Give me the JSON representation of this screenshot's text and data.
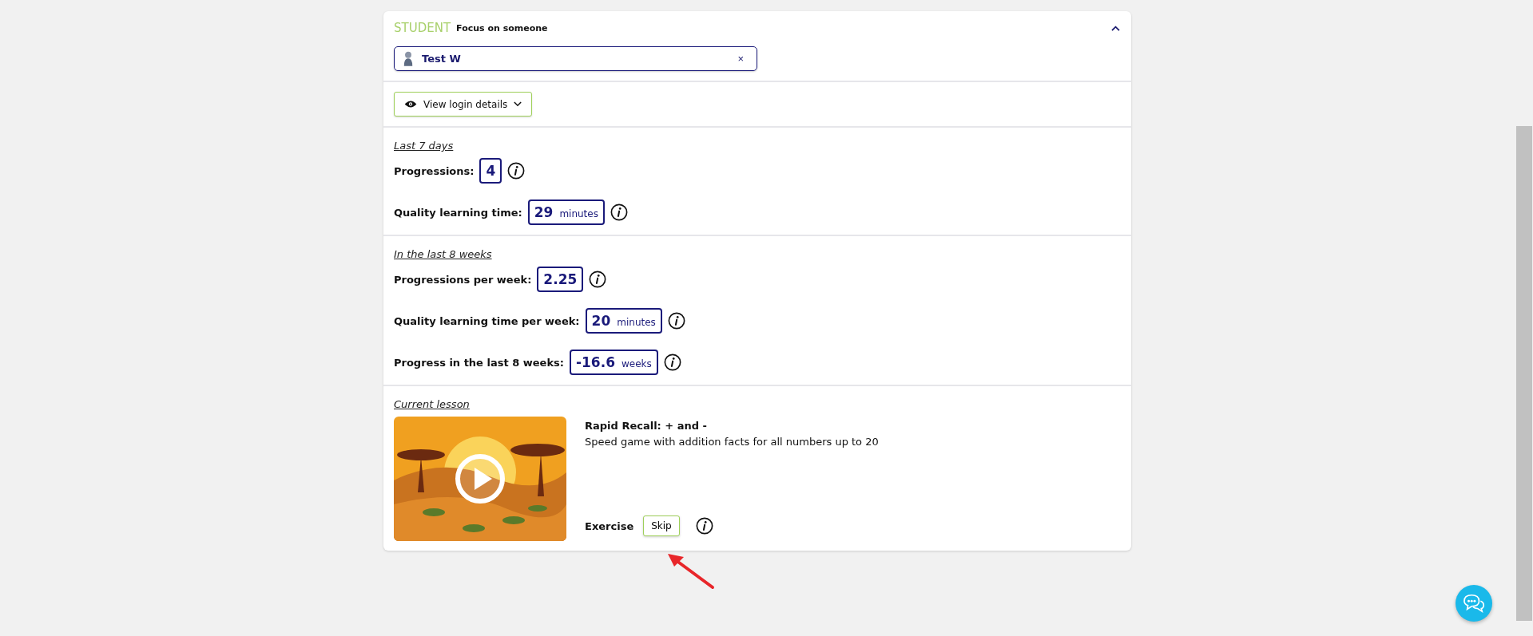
{
  "student": {
    "label": "STUDENT",
    "caption": "Focus on someone",
    "expanded": true,
    "selected_name": "Test W",
    "clear": "×"
  },
  "login_button": {
    "label": "View login details",
    "expanded": false
  },
  "sections": [
    {
      "heading": "Last 7 days",
      "stats": [
        {
          "label": "Progressions:",
          "value": "4"
        },
        {
          "label": "Quality learning time:",
          "value": "29",
          "unit": "minutes"
        }
      ]
    },
    {
      "heading": "In the last 8 weeks",
      "stats": [
        {
          "label": "Progressions per week:",
          "value": "2.25"
        },
        {
          "label": "Quality learning time per week:",
          "value": "20",
          "unit": "minutes"
        },
        {
          "label": "Progress in the last 8 weeks:",
          "value": "-16.6",
          "unit": "weeks"
        }
      ]
    }
  ],
  "lesson": {
    "heading": "Current lesson",
    "title": "Rapid Recall: + and -",
    "description": "Speed game with addition facts for all numbers up to 20",
    "type": "Exercise",
    "skip": "Skip"
  }
}
